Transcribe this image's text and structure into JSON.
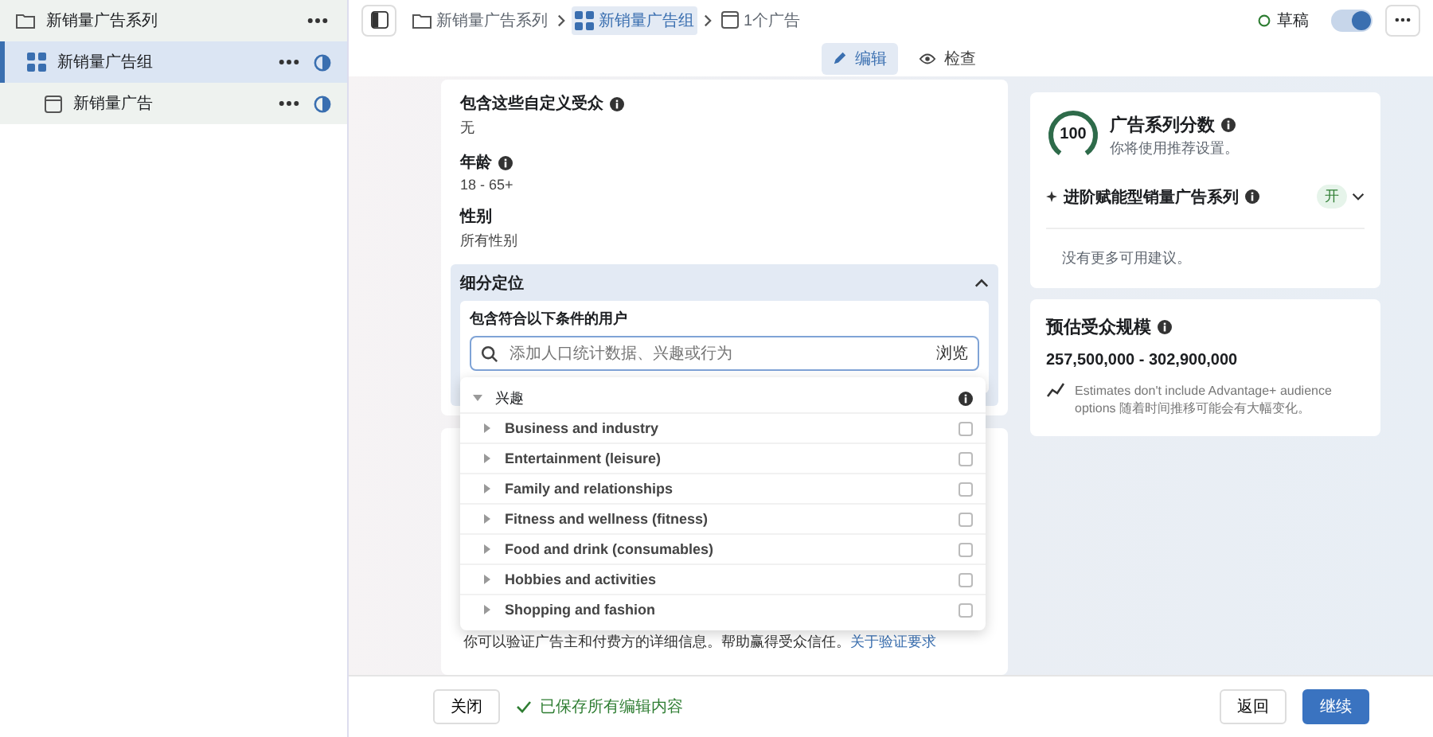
{
  "sidebar": {
    "items": [
      {
        "kind": "campaign",
        "label": "新销量广告系列",
        "selected": false
      },
      {
        "kind": "adset",
        "label": "新销量广告组",
        "selected": true
      },
      {
        "kind": "ad",
        "label": "新销量广告",
        "selected": false
      }
    ]
  },
  "breadcrumbs": [
    {
      "kind": "campaign",
      "label": "新销量广告系列",
      "selected": false
    },
    {
      "kind": "adset",
      "label": "新销量广告组",
      "selected": true
    },
    {
      "kind": "ad",
      "label": "1个广告",
      "selected": false
    }
  ],
  "status": {
    "label": "草稿"
  },
  "publish_switch": {
    "on": true
  },
  "tabs": [
    {
      "kind": "edit",
      "label": "编辑",
      "selected": true
    },
    {
      "kind": "review",
      "label": "检查",
      "selected": false
    }
  ],
  "audience_fields": [
    {
      "label": "包含这些自定义受众",
      "info": true,
      "value": "无"
    },
    {
      "label": "年龄",
      "info": true,
      "value": "18 - 65+"
    },
    {
      "label": "性别",
      "info": false,
      "value": "所有性别"
    }
  ],
  "detailed_targeting": {
    "title": "细分定位",
    "expanded": true,
    "include_label": "包含符合以下条件的用户",
    "search": {
      "placeholder": "添加人口统计数据、兴趣或行为",
      "browse": "浏览"
    },
    "dropdown": [
      {
        "label": "兴趣",
        "expanded": true,
        "children": [
          {
            "label": "Business and industry",
            "checked": false,
            "expanded": false
          },
          {
            "label": "Entertainment (leisure)",
            "checked": false,
            "expanded": false
          },
          {
            "label": "Family and relationships",
            "checked": false,
            "expanded": false
          },
          {
            "label": "Fitness and wellness (fitness)",
            "checked": false,
            "expanded": false
          },
          {
            "label": "Food and drink (consumables)",
            "checked": false,
            "expanded": false
          },
          {
            "label": "Hobbies and activities",
            "checked": false,
            "expanded": false
          },
          {
            "label": "Shopping and fashion",
            "checked": false,
            "expanded": false
          }
        ]
      }
    ]
  },
  "verification": {
    "text": "你可以验证广告主和付费方的详细信息。帮助赢得受众信任。",
    "link": "关于验证要求"
  },
  "score_card": {
    "score": "100",
    "level": 1,
    "title": "广告系列分数",
    "subtitle": "你将使用推荐设置。",
    "advantage": {
      "label": "进阶赋能型销量广告系列",
      "badge": "开"
    },
    "note": "没有更多可用建议。"
  },
  "audience_size": {
    "title": "预估受众规模",
    "range": "257,500,000 - 302,900,000",
    "note": "Estimates don't include Advantage+ audience options 随着时间推移可能会有大幅变化。"
  },
  "footer": {
    "close": "关闭",
    "saved": "已保存所有编辑内容",
    "back": "返回",
    "continue": "继续"
  }
}
